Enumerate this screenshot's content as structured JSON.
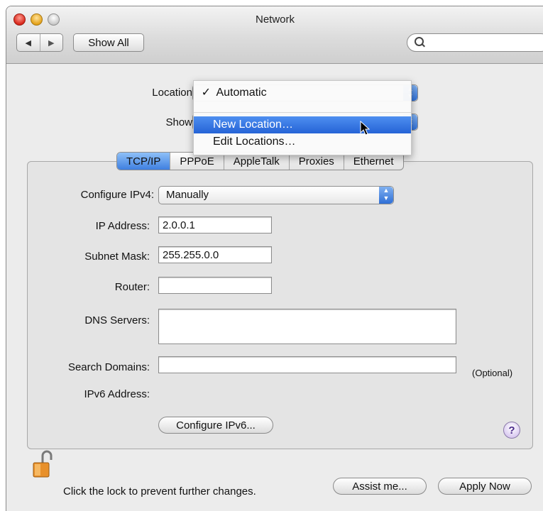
{
  "window": {
    "title": "Network"
  },
  "toolbar": {
    "back_label": "◀",
    "forward_label": "▶",
    "show_all_label": "Show All",
    "search_value": ""
  },
  "location": {
    "label": "Location",
    "value": "Automatic"
  },
  "show": {
    "label": "Show"
  },
  "location_menu": {
    "items": [
      {
        "label": "Automatic",
        "checked": true
      },
      {
        "label": "New Location…",
        "highlighted": true
      },
      {
        "label": "Edit Locations…"
      }
    ],
    "check_mark": "✓"
  },
  "tabs": [
    {
      "label": "TCP/IP",
      "active": true
    },
    {
      "label": "PPPoE"
    },
    {
      "label": "AppleTalk"
    },
    {
      "label": "Proxies"
    },
    {
      "label": "Ethernet"
    }
  ],
  "tcpip": {
    "configure_ipv4_label": "Configure IPv4:",
    "configure_ipv4_value": "Manually",
    "ip_address_label": "IP Address:",
    "ip_address_value": "2.0.0.1",
    "subnet_mask_label": "Subnet Mask:",
    "subnet_mask_value": "255.255.0.0",
    "router_label": "Router:",
    "router_value": "",
    "dns_label": "DNS Servers:",
    "dns_value": "",
    "search_domains_label": "Search Domains:",
    "search_domains_value": "",
    "optional_label": "(Optional)",
    "ipv6_address_label": "IPv6 Address:",
    "configure_ipv6_label": "Configure IPv6..."
  },
  "help_label": "?",
  "footer": {
    "lock_message": "Click the lock to prevent further changes.",
    "assist_label": "Assist me...",
    "apply_label": "Apply Now"
  },
  "colors": {
    "accent": "#2f6fd6",
    "selection": "#2563d6",
    "lock": "#e8902a"
  }
}
